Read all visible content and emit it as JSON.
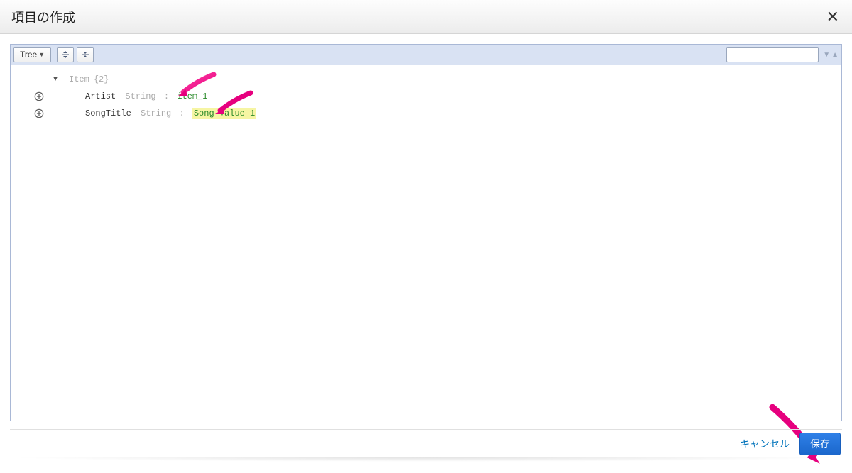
{
  "header": {
    "title": "項目の作成"
  },
  "toolbar": {
    "view_mode": "Tree",
    "search_placeholder": ""
  },
  "tree": {
    "root": {
      "name": "Item",
      "count_label": "{2}"
    },
    "rows": [
      {
        "key": "Artist",
        "type": "String",
        "value": "item_1",
        "highlight": false
      },
      {
        "key": "SongTitle",
        "type": "String",
        "value": "Song Value 1",
        "highlight": true
      }
    ]
  },
  "footer": {
    "cancel_label": "キャンセル",
    "save_label": "保存"
  }
}
